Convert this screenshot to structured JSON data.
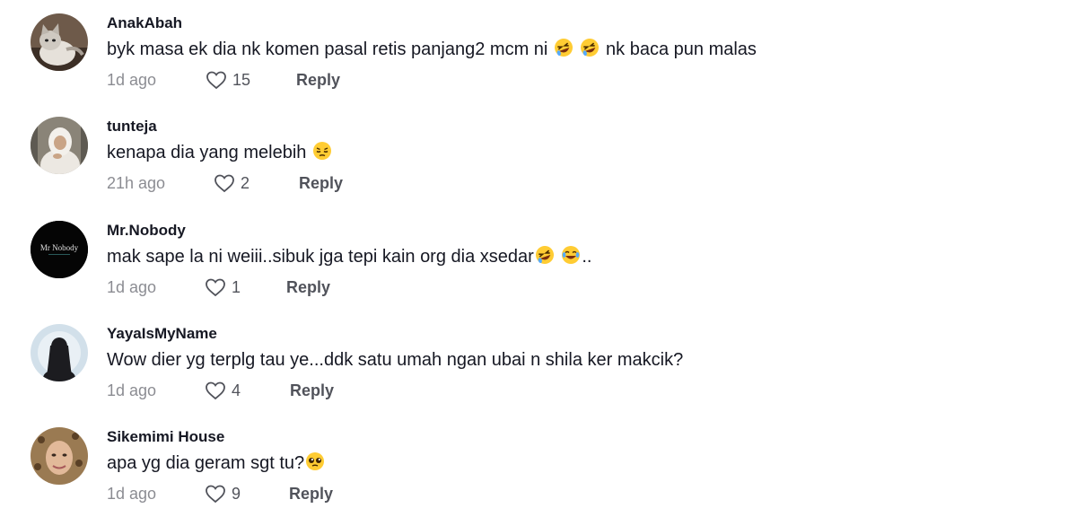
{
  "comments": [
    {
      "username": "AnakAbah",
      "text": "byk masa ek dia nk komen pasal retis panjang2 mcm ni",
      "text_after": "nk baca pun malas",
      "time": "1d ago",
      "likes": "15",
      "reply_label": "Reply",
      "avatar_icon": "cat-photo-avatar"
    },
    {
      "username": "tunteja",
      "text": "kenapa dia yang melebih",
      "time": "21h ago",
      "likes": "2",
      "reply_label": "Reply",
      "avatar_icon": "hijab-woman-photo-avatar"
    },
    {
      "username": "Mr.Nobody",
      "text": "mak sape la ni weiii..sibuk jga tepi kain org dia xsedar",
      "text_after": "..",
      "time": "1d ago",
      "likes": "1",
      "reply_label": "Reply",
      "avatar_text": "Mr Nobody",
      "avatar_icon": "mr-nobody-logo-avatar"
    },
    {
      "username": "YayaIsMyName",
      "text": "Wow dier yg terplg tau ye...ddk satu umah ngan ubai n shila ker makcik?",
      "time": "1d ago",
      "likes": "4",
      "reply_label": "Reply",
      "avatar_icon": "silhouette-avatar"
    },
    {
      "username": "Sikemimi House",
      "text": "apa yg dia geram sgt tu?",
      "time": "1d ago",
      "likes": "9",
      "reply_label": "Reply",
      "avatar_icon": "woman-photo-avatar"
    }
  ]
}
